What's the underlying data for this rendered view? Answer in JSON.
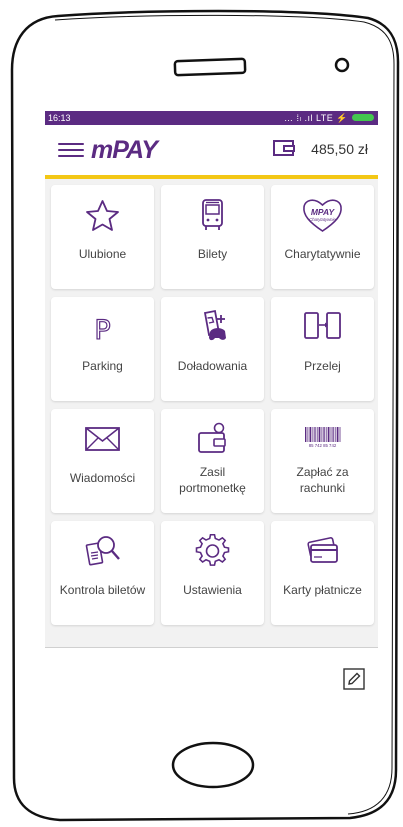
{
  "status_bar": {
    "time": "16:13",
    "network": "… ⁞ₗ .ıl LTE ⚡"
  },
  "app_bar": {
    "logo": "mPAY",
    "balance": "485,50 zł"
  },
  "tiles": [
    {
      "label": "Ulubione",
      "icon": "star-icon"
    },
    {
      "label": "Bilety",
      "icon": "bus-icon"
    },
    {
      "label": "Charytatywnie",
      "icon": "heart-icon",
      "icon_text_1": "MPAY",
      "icon_text_2": "Charytatywnie"
    },
    {
      "label": "Parking",
      "icon": "parking-icon",
      "icon_text_1": "P"
    },
    {
      "label": "Doładowania",
      "icon": "topup-icon"
    },
    {
      "label": "Przelej",
      "icon": "transfer-icon"
    },
    {
      "label": "Wiadomości",
      "icon": "envelope-icon"
    },
    {
      "label_line1": "Zasil",
      "label_line2": "portmonetkę",
      "icon": "wallet-topup-icon"
    },
    {
      "label_line1": "Zapłać za",
      "label_line2": "rachunki",
      "icon": "barcode-icon",
      "icon_text_1": "85 742 85 742"
    },
    {
      "label": "Kontrola biletów",
      "icon": "ticket-check-icon"
    },
    {
      "label": "Ustawienia",
      "icon": "gear-icon"
    },
    {
      "label": "Karty płatnicze",
      "icon": "cards-icon"
    }
  ],
  "colors": {
    "brand": "#5b2b82",
    "accent": "#f3c715",
    "battery": "#43c64f"
  }
}
